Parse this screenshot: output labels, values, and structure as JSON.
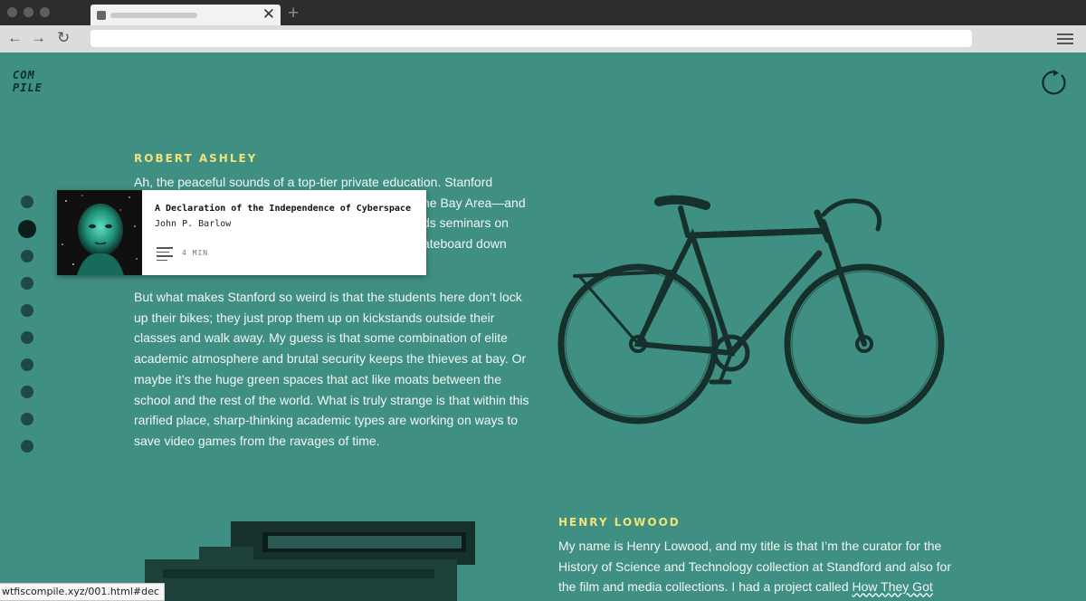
{
  "browser": {
    "close_glyph": "✕",
    "new_tab_glyph": "+",
    "back_glyph": "←",
    "forward_glyph": "→",
    "reload_glyph": "↻",
    "status_url": "wtfiscompile.xyz/001.html#dec"
  },
  "site": {
    "logo_line1": "COM",
    "logo_line2": "PILE",
    "refresh_icon": "refresh-icon"
  },
  "rail": {
    "count": 10,
    "active_index": 1
  },
  "popup": {
    "title": "A Declaration of the Independence of Cyberspace",
    "author": "John P. Barlow",
    "read_time": "4 MIN",
    "icon": "text-lines-icon"
  },
  "article1": {
    "author": "ROBERT ASHLEY",
    "p1_line1": "Ah, the peaceful sounds of a top-tier private education. Stanford",
    "p1_line2": "ne Bay Area—and",
    "p1_line3": "ds seminars on",
    "p1_line4": "ateboard down",
    "p2": "But what makes Stanford so weird is that the students here don’t lock up their bikes; they just prop them up on kickstands outside their classes and walk away. My guess is that some combination of elite academic atmosphere and brutal security keeps the thieves at bay. Or maybe it’s the huge green spaces that act like moats between the school and the rest of the world. What is truly strange is that within this rarified place, sharp-thinking academic types are working on ways to save video games from the ravages of time."
  },
  "article2": {
    "author": "HENRY LOWOOD",
    "p1": "My name is Henry Lowood, and my title is that I’m the curator for the History of Science and Technology collection at Standford and also for the film and media collections. I had a project called ",
    "link": "How They Got"
  },
  "colors": {
    "background": "#3f8f82",
    "author_accent": "#f1e27a",
    "rail_dot": "#1f4a44"
  }
}
